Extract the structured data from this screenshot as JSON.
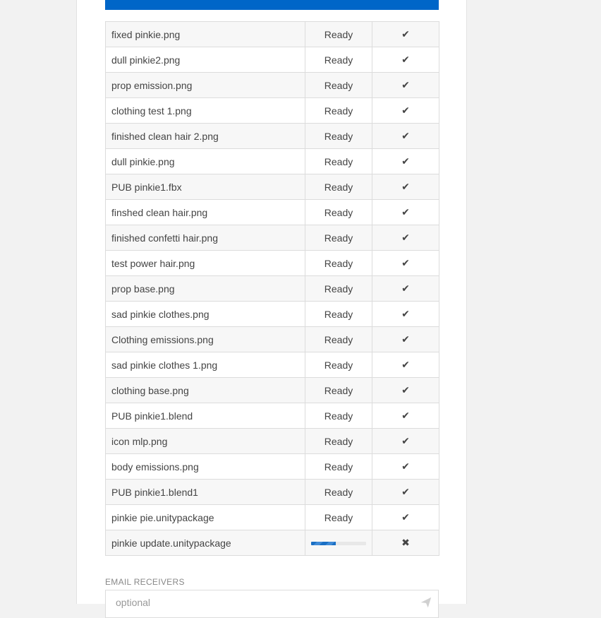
{
  "files": [
    {
      "name": "fixed pinkie.png",
      "status": "Ready",
      "mark": "✔"
    },
    {
      "name": "dull pinkie2.png",
      "status": "Ready",
      "mark": "✔"
    },
    {
      "name": "prop emission.png",
      "status": "Ready",
      "mark": "✔"
    },
    {
      "name": "clothing test 1.png",
      "status": "Ready",
      "mark": "✔"
    },
    {
      "name": "finished clean hair 2.png",
      "status": "Ready",
      "mark": "✔"
    },
    {
      "name": "dull pinkie.png",
      "status": "Ready",
      "mark": "✔"
    },
    {
      "name": "PUB pinkie1.fbx",
      "status": "Ready",
      "mark": "✔"
    },
    {
      "name": "finshed clean hair.png",
      "status": "Ready",
      "mark": "✔"
    },
    {
      "name": "finished confetti hair.png",
      "status": "Ready",
      "mark": "✔"
    },
    {
      "name": "test power hair.png",
      "status": "Ready",
      "mark": "✔"
    },
    {
      "name": "prop base.png",
      "status": "Ready",
      "mark": "✔"
    },
    {
      "name": "sad pinkie clothes.png",
      "status": "Ready",
      "mark": "✔"
    },
    {
      "name": "Clothing emissions.png",
      "status": "Ready",
      "mark": "✔"
    },
    {
      "name": "sad pinkie clothes 1.png",
      "status": "Ready",
      "mark": "✔"
    },
    {
      "name": "clothing base.png",
      "status": "Ready",
      "mark": "✔"
    },
    {
      "name": "PUB pinkie1.blend",
      "status": "Ready",
      "mark": "✔"
    },
    {
      "name": "icon mlp.png",
      "status": "Ready",
      "mark": "✔"
    },
    {
      "name": "body emissions.png",
      "status": "Ready",
      "mark": "✔"
    },
    {
      "name": "PUB pinkie1.blend1",
      "status": "Ready",
      "mark": "✔"
    },
    {
      "name": "pinkie pie.unitypackage",
      "status": "Ready",
      "mark": "✔"
    }
  ],
  "uploading": {
    "name": "pinkie update.unitypackage",
    "progress_fraction": 0.45,
    "mark": "✖"
  },
  "email": {
    "label": "EMAIL RECEIVERS",
    "placeholder": "optional"
  },
  "icons": {
    "ready": "check-icon",
    "uploading": "cancel-icon",
    "send": "send-icon"
  },
  "colors": {
    "accent": "#0066c8"
  }
}
